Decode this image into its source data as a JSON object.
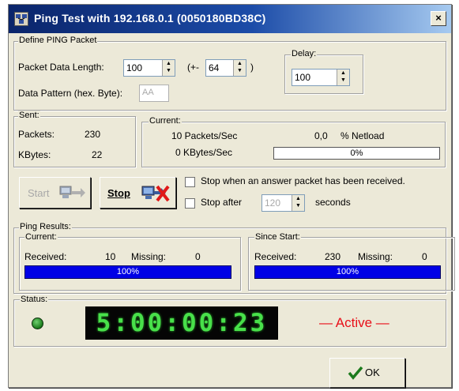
{
  "window": {
    "title": "Ping Test with 192.168.0.1  (0050180BD38C)",
    "close_label": "×",
    "title_icon": "computer-network-icon"
  },
  "define": {
    "legend": "Define PING Packet",
    "packet_length_label": "Packet Data Length:",
    "packet_length_value": "100",
    "plus_prefix": "(+-",
    "plus_value": "64",
    "plus_suffix": ")",
    "delay_legend": "Delay:",
    "delay_value": "100",
    "pattern_label": "Data Pattern (hex. Byte):",
    "pattern_value": "AA"
  },
  "sent": {
    "legend": "Sent:",
    "packets_label": "Packets:",
    "packets_value": "230",
    "kbytes_label": "KBytes:",
    "kbytes_value": "22"
  },
  "current_rate": {
    "legend": "Current:",
    "packets_per_sec": "10 Packets/Sec",
    "netload_value": "0,0",
    "netload_label": "% Netload",
    "kbytes_per_sec": "0 KBytes/Sec",
    "netload_bar_text": "0%",
    "netload_fraction": 0
  },
  "controls": {
    "start_label": "Start",
    "stop_label": "Stop",
    "stop_answer_label": "Stop when an answer packet has been received.",
    "stop_after_label": "Stop after",
    "stop_after_value": "120",
    "seconds_label": "seconds",
    "stop_answer_checked": false,
    "stop_after_checked": false
  },
  "results": {
    "legend": "Ping Results:",
    "current": {
      "legend": "Current:",
      "received_label": "Received:",
      "received_value": "10",
      "missing_label": "Missing:",
      "missing_value": "0",
      "bar_text": "100%",
      "fraction": 1.0
    },
    "since_start": {
      "legend": "Since Start:",
      "received_label": "Received:",
      "received_value": "230",
      "missing_label": "Missing:",
      "missing_value": "0",
      "bar_text": "100%",
      "fraction": 1.0
    }
  },
  "status": {
    "legend": "Status:",
    "clock": "5:00:00:23",
    "state": "— Active —",
    "led_color": "#2aa82a",
    "state_color": "#e8101a"
  },
  "ok_label": "OK",
  "colors": {
    "title_bar": "#0a246a",
    "progress": "#0000e6",
    "clock_digits": "#48e04a"
  }
}
